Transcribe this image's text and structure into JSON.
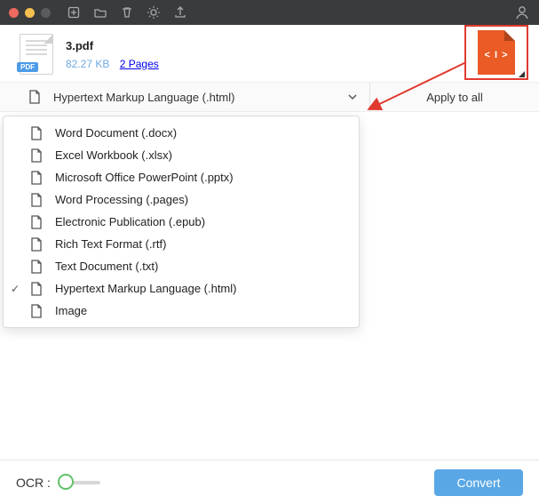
{
  "traffic": {
    "close": "#ed6a5e",
    "min": "#f4bf4f",
    "max": "#5a5b5c"
  },
  "theme": {
    "accent": "#5aa7e6",
    "highlight": "#e03a2f"
  },
  "file": {
    "name": "3.pdf",
    "size": "82.27 KB",
    "pages": "2 Pages",
    "thumb_glyph": "< I >"
  },
  "selector": {
    "icon": "html-icon",
    "label": "Hypertext Markup Language (.html)",
    "apply_all": "Apply to all"
  },
  "dropdown": [
    {
      "label": "Word Document (.docx)",
      "checked": false
    },
    {
      "label": "Excel Workbook (.xlsx)",
      "checked": false
    },
    {
      "label": "Microsoft Office PowerPoint (.pptx)",
      "checked": false
    },
    {
      "label": "Word Processing (.pages)",
      "checked": false
    },
    {
      "label": "Electronic Publication (.epub)",
      "checked": false
    },
    {
      "label": "Rich Text Format (.rtf)",
      "checked": false
    },
    {
      "label": "Text Document (.txt)",
      "checked": false
    },
    {
      "label": "Hypertext Markup Language (.html)",
      "checked": true
    },
    {
      "label": "Image",
      "checked": false
    }
  ],
  "footer": {
    "ocr_label": "OCR :",
    "ocr_on": false,
    "convert_label": "Convert"
  }
}
